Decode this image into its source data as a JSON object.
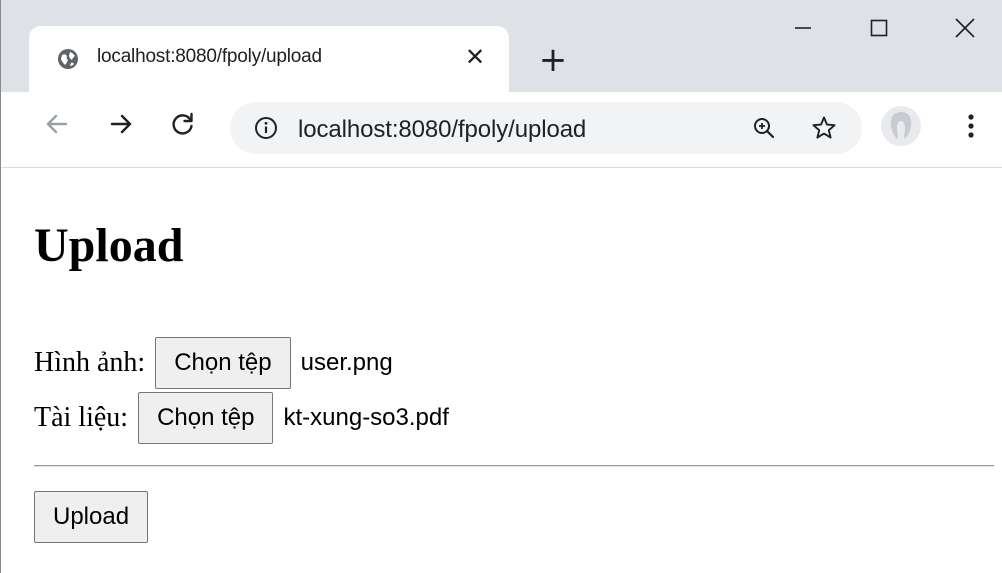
{
  "browser": {
    "tab": {
      "title": "localhost:8080/fpoly/upload",
      "close_glyph": "✕",
      "icon": "globe-icon"
    },
    "new_tab_glyph": "+",
    "window_controls": [
      "minimize-icon",
      "maximize-icon",
      "close-icon"
    ],
    "toolbar": {
      "back_icon": "arrow-left-icon",
      "forward_icon": "arrow-right-icon",
      "reload_icon": "reload-icon",
      "url": "localhost:8080/fpoly/upload",
      "info_icon": "info-icon",
      "zoom_icon": "zoom-icon",
      "bookmark_icon": "star-icon",
      "profile_icon": "avatar-icon",
      "menu_icon": "kebab-menu-icon"
    }
  },
  "page": {
    "title": "Upload",
    "fields": [
      {
        "label": "Hình ảnh:",
        "button": "Chọn tệp",
        "file": "user.png"
      },
      {
        "label": "Tài liệu:",
        "button": "Chọn tệp",
        "file": "kt-xung-so3.pdf"
      }
    ],
    "submit_label": "Upload"
  },
  "colors": {
    "tabstrip": "#dee1e6",
    "omnibox": "#f1f3f4",
    "button_bg": "#efefef",
    "button_border": "#767676"
  }
}
